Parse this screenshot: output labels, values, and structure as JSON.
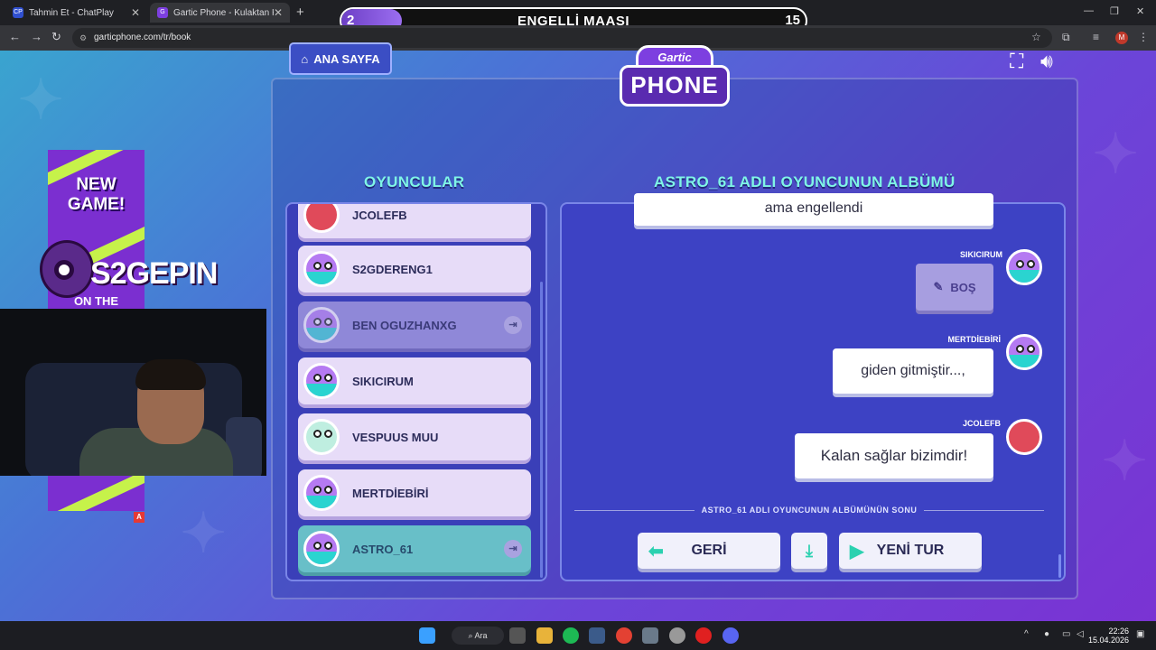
{
  "browser": {
    "tabs": [
      {
        "label": "Tahmin Et - ChatPlay",
        "favicon": "CP"
      },
      {
        "label": "Gartic Phone - Kulaktan Kulağa",
        "favicon": "G"
      }
    ],
    "url": "garticphone.com/tr/book",
    "profile_initial": "M"
  },
  "overlay": {
    "left_number": "2",
    "title": "ENGELLİ MAAŞI",
    "right_number": "15",
    "progress_fraction": 0.13
  },
  "game": {
    "home_label": "ANA SAYFA",
    "logo_top": "Gartic",
    "logo_bottom": "PHONE",
    "players_title": "OYUNCULAR",
    "album_title": "ASTRO_61 ADLI OYUNCUNUN ALBÜMÜ",
    "players": [
      {
        "name": "JCOLEFB",
        "state": "normal",
        "avatar": "knight"
      },
      {
        "name": "S2GDERENG1",
        "state": "normal",
        "avatar": "bird"
      },
      {
        "name": "BEN OGUZHANXG",
        "state": "dim",
        "avatar": "bird"
      },
      {
        "name": "SIKICIRUM",
        "state": "normal",
        "avatar": "bird"
      },
      {
        "name": "VESPUUS MUU",
        "state": "normal",
        "avatar": "ghost"
      },
      {
        "name": "MERTDİEBİRİ",
        "state": "normal",
        "avatar": "bird"
      },
      {
        "name": "ASTRO_61",
        "state": "active",
        "avatar": "bird"
      }
    ],
    "messages": [
      {
        "author": "",
        "text": "ama engellendi"
      },
      {
        "author": "SIKICIRUM",
        "text": "BOŞ",
        "empty": true
      },
      {
        "author": "MERTDİEBİRİ",
        "text": "giden gitmiştir...,"
      },
      {
        "author": "JCOLEFB",
        "text": "Kalan sağlar bizimdir!"
      }
    ],
    "album_end": "ASTRO_61 ADLI OYUNCUNUN ALBÜMÜNÜN SONU",
    "back_label": "GERİ",
    "new_round_label": "YENİ TUR"
  },
  "stream": {
    "banner_text": "NEW GAME!",
    "brand": "S2GEPIN",
    "banner_sub": "ON THE CREATORS"
  },
  "taskbar": {
    "search_label": "Ara",
    "time": "22:26",
    "date": "15.04.2026"
  },
  "colors": {
    "accent_teal": "#7ff5e6",
    "panel": "#3d42c4",
    "active_player": "#68bfc8"
  }
}
